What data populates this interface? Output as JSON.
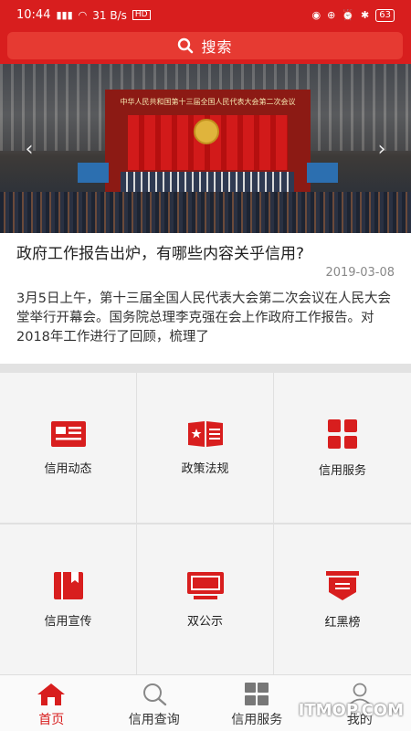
{
  "status_bar": {
    "time": "10:44",
    "network_speed": "31 B/s",
    "hd_label": "HD",
    "battery": "63"
  },
  "search": {
    "label": "搜索"
  },
  "banner": {
    "stage_title": "中华人民共和国第十三届全国人民代表大会第二次会议",
    "slide_count": 3,
    "active_slide": 1
  },
  "news": {
    "title": "政府工作报告出炉，有哪些内容关乎信用?",
    "date": "2019-03-08",
    "body": "3月5日上午，第十三届全国人民代表大会第二次会议在人民大会堂举行开幕会。国务院总理李克强在会上作政府工作报告。对2018年工作进行了回顾，梳理了"
  },
  "grid": [
    {
      "label": "信用动态",
      "icon": "news-card-icon"
    },
    {
      "label": "政策法规",
      "icon": "book-star-icon"
    },
    {
      "label": "信用服务",
      "icon": "grid-four-icon"
    },
    {
      "label": "信用宣传",
      "icon": "bookmark-book-icon"
    },
    {
      "label": "双公示",
      "icon": "monitor-icon"
    },
    {
      "label": "红黑榜",
      "icon": "shield-list-icon"
    }
  ],
  "bottom_nav": [
    {
      "label": "首页",
      "icon": "home-icon",
      "active": true
    },
    {
      "label": "信用查询",
      "icon": "search-icon",
      "active": false
    },
    {
      "label": "信用服务",
      "icon": "grid-icon",
      "active": false
    },
    {
      "label": "我的",
      "icon": "user-icon",
      "active": false
    }
  ],
  "watermark": "ITMOP.COM",
  "colors": {
    "brand_red": "#d81e1e",
    "active_dot": "#2e8ee6"
  }
}
